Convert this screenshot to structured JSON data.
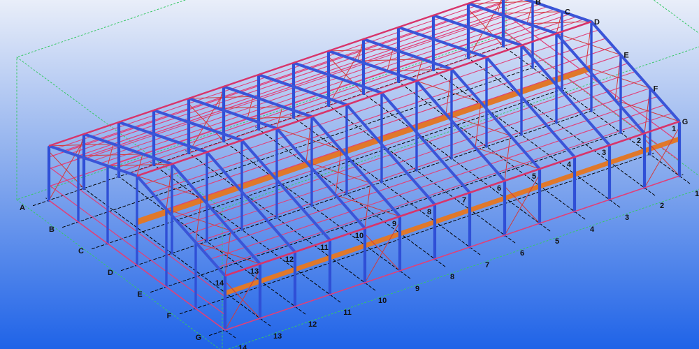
{
  "colors": {
    "background_top": "#e9eef9",
    "background_bottom": "#1f63e8",
    "column": "#2f4fd6",
    "rafter": "#3a55d8",
    "purlin": "#e0407a",
    "eave_strut": "#d8346a",
    "bracing": "#d23b3b",
    "girder": "#e0782a",
    "gridline": "#000000",
    "bounding_box": "#37c865",
    "label": "#111111"
  },
  "icons": {
    "column": "blue-steel-column",
    "rafter": "blue-steel-rafter",
    "purlin": "pink-purlin",
    "bracing": "red-x-bracing",
    "girder": "orange-crane-girder"
  },
  "gridlines": {
    "numbers": [
      "1",
      "2",
      "3",
      "4",
      "5",
      "6",
      "7",
      "8",
      "9",
      "10",
      "11",
      "12",
      "13",
      "14"
    ],
    "letters": [
      "A",
      "B",
      "C",
      "D",
      "E",
      "F",
      "G"
    ]
  }
}
